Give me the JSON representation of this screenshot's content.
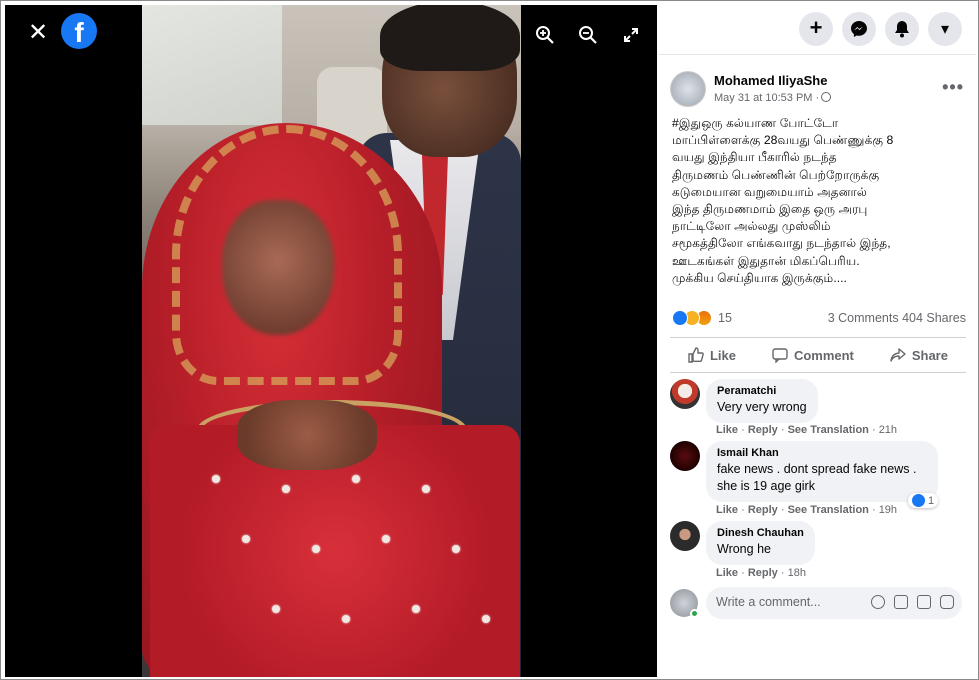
{
  "viewer": {
    "close_glyph": "✕",
    "fb_logo_text": "f",
    "tools": [
      "zoom-in",
      "zoom-out",
      "fullscreen"
    ]
  },
  "topbar": {
    "buttons": [
      "plus-icon",
      "messenger-icon",
      "bell-icon",
      "caret-down-icon"
    ],
    "add_glyph": "+",
    "menu_glyph": "▾"
  },
  "post": {
    "author": "Mohamed IliyaShe",
    "time": "May 31 at 10:53 PM ·",
    "more_glyph": "•••",
    "text_lines": [
      "#இதுஒரு கல்யாண போட்டோ",
      "மாப்பிள்ளைக்கு 28வயது பெண்ணுக்கு 8",
      "வயது இந்தியா பீகாரில் நடந்த",
      "திருமணம் பெண்ணின் பெற்றோருக்கு",
      "கடுமையான வறுமையாம் அதனால்",
      "இந்த திருமணமாம் இதை ஒரு அரபு",
      "நாட்டிலோ அல்லது முஸ்லிம்",
      "சமூகத்திலோ எங்கவாது நடந்தால் இந்த,",
      "ஊடகங்கள் இதுதான் மிகப்பெரிய.",
      "முக்கிய செய்தியாக இருக்கும்...."
    ],
    "reaction_count": "15",
    "comments_count": "3 Comments",
    "shares_count": "404 Shares"
  },
  "actions": {
    "like": "Like",
    "comment": "Comment",
    "share": "Share"
  },
  "comments": [
    {
      "name": "Peramatchi",
      "text": "Very very wrong",
      "like": "Like",
      "reply": "Reply",
      "translate": "See Translation",
      "time": "21h",
      "sep": "·"
    },
    {
      "name": "Ismail Khan",
      "text_lines": [
        "fake news . dont spread fake news .",
        "she is 19 age girk"
      ],
      "like": "Like",
      "reply": "Reply",
      "translate": "See Translation",
      "time": "19h",
      "reaction_count": "1",
      "sep": "·"
    },
    {
      "name": "Dinesh Chauhan",
      "text": "Wrong he",
      "like": "Like",
      "reply": "Reply",
      "time": "18h",
      "sep": "·"
    }
  ],
  "composer": {
    "placeholder": "Write a comment..."
  },
  "colors": {
    "fb_blue": "#1877f2",
    "secondary_text": "#65676b",
    "bubble_bg": "#f0f2f5"
  }
}
